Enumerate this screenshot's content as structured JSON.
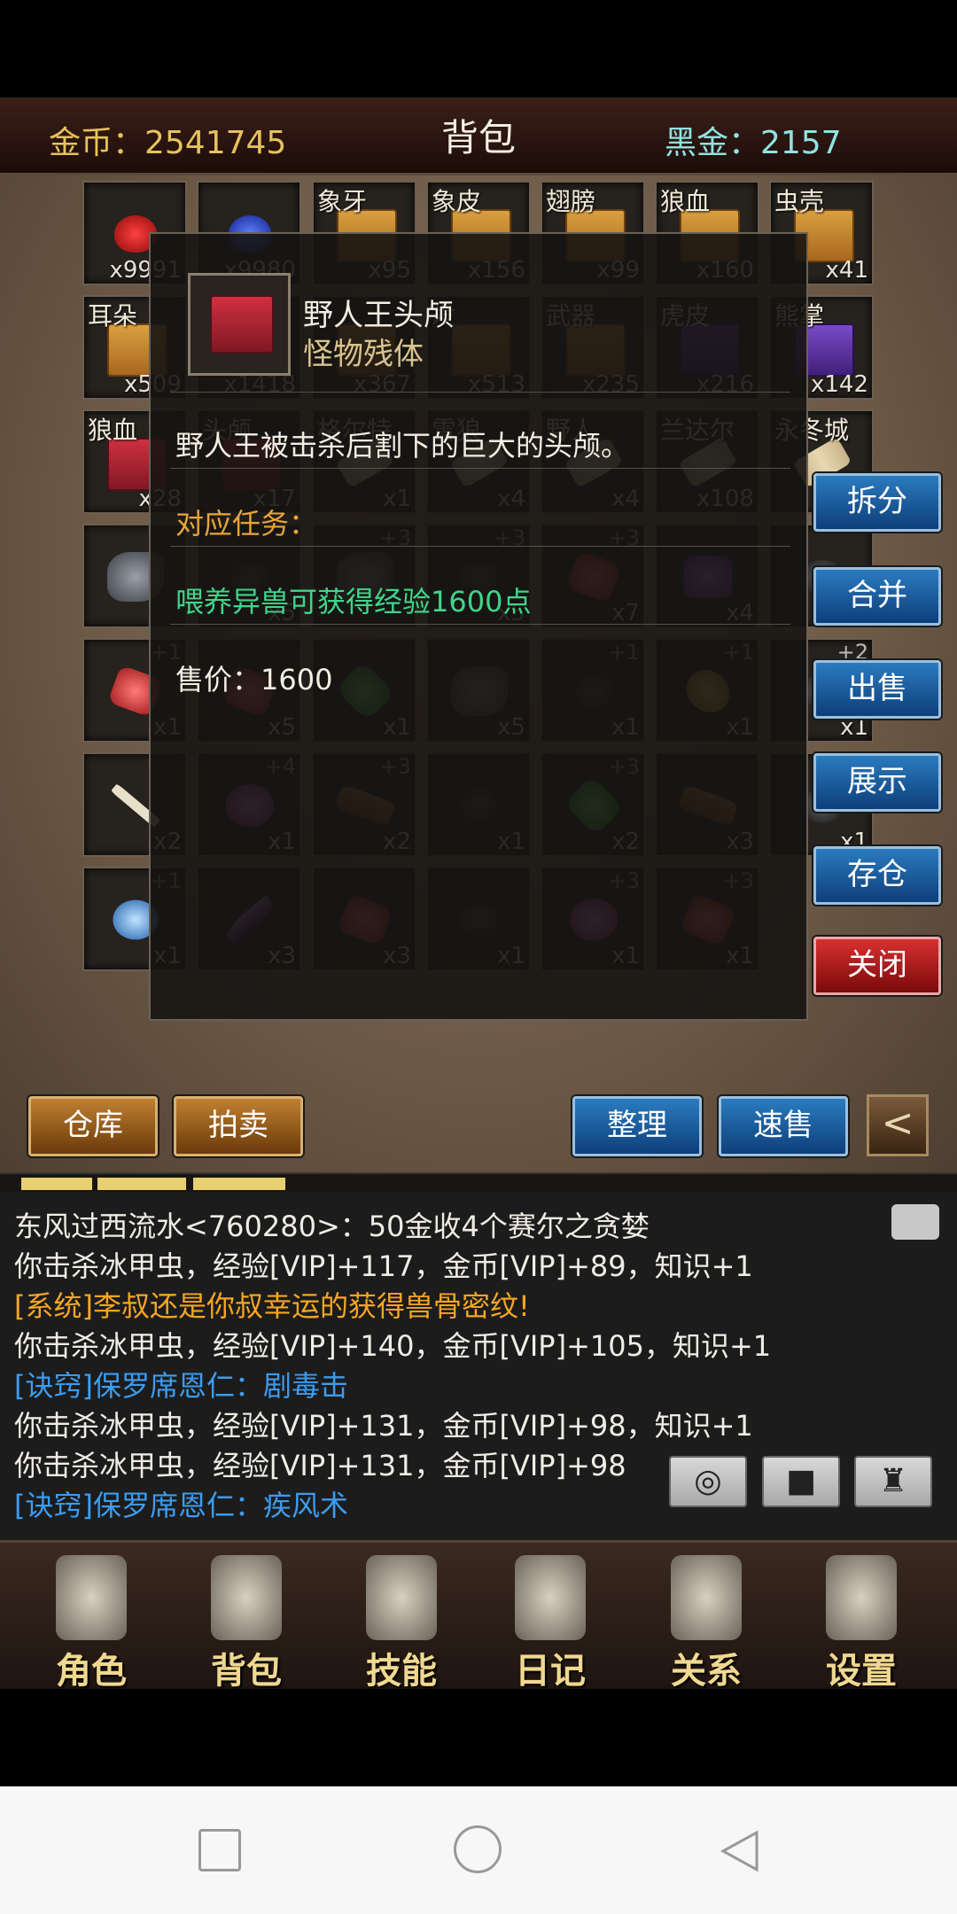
{
  "header": {
    "gold_label": "金币：2541745",
    "title": "背包",
    "black_gold_label": "黑金：2157"
  },
  "grid": [
    {
      "name": "",
      "count": "x9991",
      "icon": "potion-red"
    },
    {
      "name": "",
      "count": "x9980",
      "icon": "potion-blue"
    },
    {
      "name": "象牙",
      "count": "x95",
      "icon": "crate"
    },
    {
      "name": "象皮",
      "count": "x156",
      "icon": "crate"
    },
    {
      "name": "翅膀",
      "count": "x99",
      "icon": "crate"
    },
    {
      "name": "狼血",
      "count": "x160",
      "icon": "crate"
    },
    {
      "name": "虫壳",
      "count": "x41",
      "icon": "crate"
    },
    {
      "name": "耳朵",
      "count": "x509",
      "icon": "crate"
    },
    {
      "name": "",
      "count": "x1418",
      "icon": "crate"
    },
    {
      "name": "",
      "count": "x367",
      "icon": "crate"
    },
    {
      "name": "发",
      "count": "x513",
      "icon": "crate"
    },
    {
      "name": "武器",
      "count": "x235",
      "icon": "crate"
    },
    {
      "name": "虎皮",
      "count": "x216",
      "icon": "crate-purple"
    },
    {
      "name": "熊掌",
      "count": "x142",
      "icon": "crate-purple"
    },
    {
      "name": "狼血",
      "count": "x28",
      "icon": "crate-red"
    },
    {
      "name": "头颅",
      "count": "x17",
      "icon": "crate-red"
    },
    {
      "name": "格尔特",
      "count": "x1",
      "icon": "scroll"
    },
    {
      "name": "雪狼",
      "count": "x4",
      "icon": "scroll"
    },
    {
      "name": "野人",
      "count": "x4",
      "icon": "scroll"
    },
    {
      "name": "兰达尔",
      "count": "x108",
      "icon": "scroll"
    },
    {
      "name": "永冬城",
      "count": "",
      "icon": "scroll"
    },
    {
      "name": "",
      "count": "",
      "icon": "ore"
    },
    {
      "name": "",
      "count": "x5",
      "icon": "dark"
    },
    {
      "name": "+3",
      "count": "",
      "icon": "ore"
    },
    {
      "name": "+3",
      "count": "x5",
      "icon": "dark"
    },
    {
      "name": "+3",
      "count": "x7",
      "icon": "red-ore"
    },
    {
      "name": "",
      "count": "x4",
      "icon": "gem-purple"
    },
    {
      "name": "",
      "count": "",
      "icon": "dark"
    },
    {
      "name": "+1",
      "count": "x1",
      "icon": "red-ore"
    },
    {
      "name": "",
      "count": "x5",
      "icon": "red-ore"
    },
    {
      "name": "",
      "count": "x1",
      "icon": "gem-green"
    },
    {
      "name": "",
      "count": "x5",
      "icon": "ore"
    },
    {
      "name": "+1",
      "count": "x1",
      "icon": "dark"
    },
    {
      "name": "+1",
      "count": "x1",
      "icon": "gold-coin"
    },
    {
      "name": "+2",
      "count": "x1",
      "icon": "dark"
    },
    {
      "name": "",
      "count": "x2",
      "icon": "bone"
    },
    {
      "name": "+4",
      "count": "x1",
      "icon": "orb-pink"
    },
    {
      "name": "+3",
      "count": "x2",
      "icon": "leather"
    },
    {
      "name": "",
      "count": "x1",
      "icon": "necklace"
    },
    {
      "name": "+3",
      "count": "x2",
      "icon": "gem-green"
    },
    {
      "name": "",
      "count": "x3",
      "icon": "wood"
    },
    {
      "name": "",
      "count": "x1",
      "icon": "dark"
    },
    {
      "name": "+1",
      "count": "x1",
      "icon": "orb-blue"
    },
    {
      "name": "",
      "count": "x3",
      "icon": "feather"
    },
    {
      "name": "",
      "count": "x3",
      "icon": "gem-red"
    },
    {
      "name": "",
      "count": "x1",
      "icon": "dark"
    },
    {
      "name": "+3",
      "count": "x1",
      "icon": "orb-pink"
    },
    {
      "name": "+3",
      "count": "x1",
      "icon": "gem-red"
    }
  ],
  "tooltip": {
    "item_name": "野人王头颅",
    "category": "怪物残体",
    "description": "野人王被击杀后割下的巨大的头颅。",
    "quest_label": "对应任务：",
    "exp_text": "喂养异兽可获得经验1600点",
    "price_text": "售价：1600"
  },
  "side_buttons": {
    "split": "拆分",
    "merge": "合并",
    "sell": "出售",
    "show": "展示",
    "store": "存仓",
    "close": "关闭"
  },
  "bottom_buttons": {
    "warehouse": "仓库",
    "auction": "拍卖",
    "sort": "整理",
    "quick_sell": "速售",
    "back": "<"
  },
  "chat": [
    {
      "text": "东风过西流水<760280>：50金收4个赛尔之贪婪",
      "color": "white"
    },
    {
      "text": "你击杀冰甲虫，经验[VIP]+117，金币[VIP]+89，知识+1",
      "color": "white"
    },
    {
      "text": "[系统]李叔还是你叔幸运的获得兽骨密纹!",
      "color": "orange"
    },
    {
      "text": "你击杀冰甲虫，经验[VIP]+140，金币[VIP]+105，知识+1",
      "color": "white"
    },
    {
      "text": "[诀窍]保罗席恩仁：剧毒击",
      "color": "blue"
    },
    {
      "text": "你击杀冰甲虫，经验[VIP]+131，金币[VIP]+98，知识+1",
      "color": "white"
    },
    {
      "text": "你击杀冰甲虫，经验[VIP]+131，金币[VIP]+98",
      "color": "white"
    },
    {
      "text": "[诀窍]保罗席恩仁：疾风术",
      "color": "blue"
    }
  ],
  "chat_icons": [
    "compass-icon",
    "stop-icon",
    "trophy-icon"
  ],
  "nav": [
    {
      "label": "角色",
      "icon": "helmet-icon"
    },
    {
      "label": "背包",
      "icon": "backpack-icon"
    },
    {
      "label": "技能",
      "icon": "skill-book-icon"
    },
    {
      "label": "日记",
      "icon": "scroll-icon"
    },
    {
      "label": "关系",
      "icon": "handshake-icon"
    },
    {
      "label": "设置",
      "icon": "gear-icon"
    }
  ],
  "system_nav": [
    "recent-apps-icon",
    "home-icon",
    "back-icon"
  ]
}
